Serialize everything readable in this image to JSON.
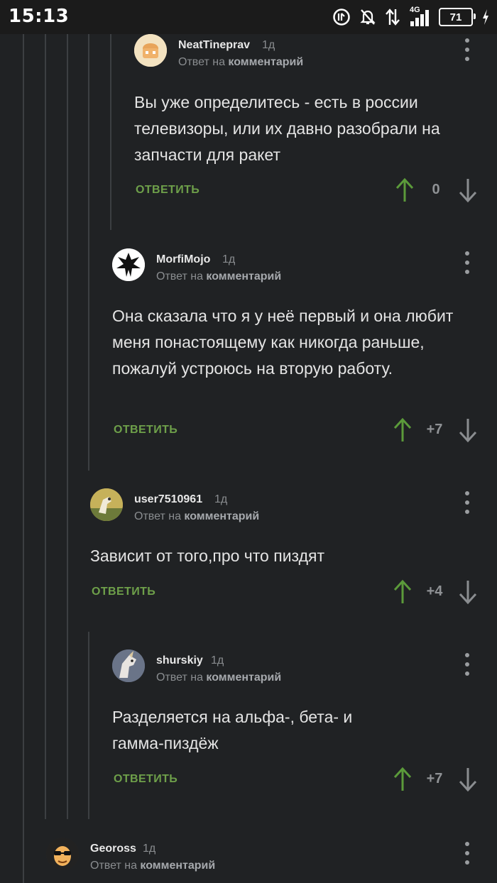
{
  "status_bar": {
    "time": "15:13",
    "network": "4G",
    "battery": "71",
    "icons": [
      "data-saver-icon",
      "bell-off-icon",
      "data-arrows-icon",
      "signal-icon",
      "battery-icon",
      "charging-icon"
    ]
  },
  "colors": {
    "background": "#202224",
    "reply_green": "#6ea04a",
    "upvote_green": "#5b9a3a",
    "thread_line": "#3c3f42"
  },
  "comments": [
    {
      "username": "NeatTineprav",
      "time": "1д",
      "reply_prefix": "Ответ на",
      "reply_target": "комментарий",
      "text": "Вы уже определитесь - есть в россии телевизоры, или их давно разобрали на запчасти для ракет",
      "reply_label": "ОТВЕТИТЬ",
      "score": "0"
    },
    {
      "username": "MorfiMojo",
      "time": "1д",
      "reply_prefix": "Ответ на",
      "reply_target": "комментарий",
      "text": "Она сказала что я у неё первый и она любит меня понастоящему как никогда раньше, пожалуй устроюсь на вторую работу.",
      "reply_label": "ОТВЕТИТЬ",
      "score": "+7"
    },
    {
      "username": "user7510961",
      "time": "1д",
      "reply_prefix": "Ответ на",
      "reply_target": "комментарий",
      "text": "Зависит от того,про что пиздят",
      "reply_label": "ОТВЕТИТЬ",
      "score": "+4"
    },
    {
      "username": "shurskiy",
      "time": "1д",
      "reply_prefix": "Ответ на",
      "reply_target": "комментарий",
      "text": "Разделяется на альфа-, бета- и гамма-пиздёж",
      "reply_label": "ОТВЕТИТЬ",
      "score": "+7"
    },
    {
      "username": "Geoross",
      "time": "1д",
      "reply_prefix": "Ответ на",
      "reply_target": "комментарий"
    }
  ]
}
